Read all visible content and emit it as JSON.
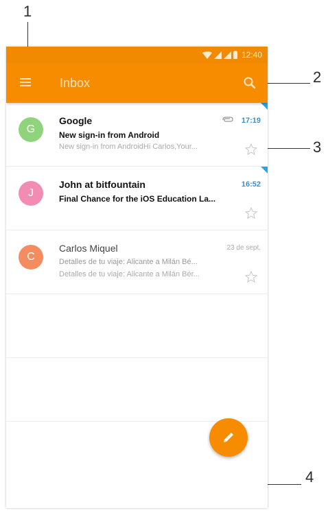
{
  "callouts": [
    "1",
    "2",
    "3",
    "4"
  ],
  "statusbar": {
    "time": "12:40"
  },
  "appbar": {
    "title": "Inbox"
  },
  "emails": [
    {
      "avatar_letter": "G",
      "avatar_color": "#8fd37a",
      "sender": "Google",
      "subject": "New sign-in from Android",
      "preview": "New sign-in from AndroidHi Carlos,Your...",
      "time": "17:19",
      "has_attachment": true,
      "unread": true
    },
    {
      "avatar_letter": "J",
      "avatar_color": "#f28cb3",
      "sender": "John at bitfountain",
      "subject": "Final Chance for the iOS Education La...",
      "preview": "",
      "time": "16:52",
      "has_attachment": false,
      "unread": true
    },
    {
      "avatar_letter": "C",
      "avatar_color": "#f48c5f",
      "sender": "Carlos Miquel",
      "subject": "Detalles de tu viaje: Alicante a Milán Bé...",
      "preview": "Detalles de tu viaje: Alicante a Milán Bér...",
      "time": "23 de sept.",
      "has_attachment": false,
      "unread": false
    }
  ],
  "colors": {
    "accent": "#f78c00",
    "status_bar": "#f18a00",
    "time_unread": "#3a8fd0",
    "unread_marker": "#29a6e0"
  },
  "icons": {
    "menu": "menu-icon",
    "search": "search-icon",
    "star": "star-outline-icon",
    "attachment": "paperclip-icon",
    "compose": "pencil-icon"
  }
}
